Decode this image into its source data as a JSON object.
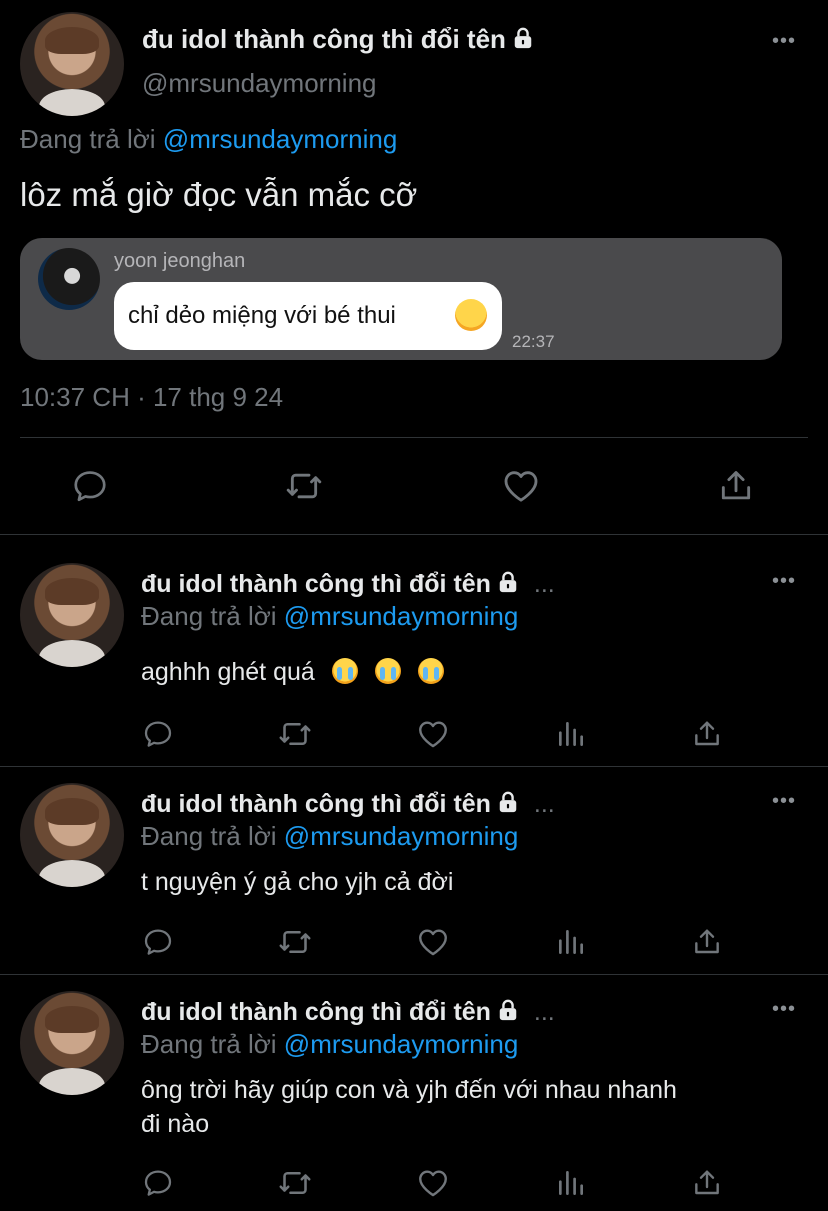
{
  "main_tweet": {
    "display_name": "đu idol thành công thì đổi tên",
    "handle": "@mrsundaymorning",
    "reply_prefix": "Đang trả lời",
    "reply_to": "@mrsundaymorning",
    "text": "lôz mắ giờ đọc vẫn mắc cỡ",
    "media": {
      "sender_name": "yoon jeonghan",
      "message": "chỉ dẻo miệng với bé thui",
      "time": "22:37"
    },
    "timestamp": "10:37 CH · 17 thg 9 24"
  },
  "replies": [
    {
      "display_name": "đu idol thành công thì đổi tên",
      "ellipsis": "...",
      "reply_prefix": "Đang trả lời",
      "reply_to": "@mrsundaymorning",
      "text": "aghhh ghét quá"
    },
    {
      "display_name": "đu idol thành công thì đổi tên",
      "ellipsis": "...",
      "reply_prefix": "Đang trả lời",
      "reply_to": "@mrsundaymorning",
      "text": "t nguyện ý gả cho yjh cả đời"
    },
    {
      "display_name": "đu idol thành công thì đổi tên",
      "ellipsis": "...",
      "reply_prefix": "Đang trả lời",
      "reply_to": "@mrsundaymorning",
      "text_line1": "ông trời hãy giúp con và yjh đến với nhau nhanh",
      "text_line2": "đi nào"
    }
  ],
  "colors": {
    "background": "#000000",
    "text": "#e7e9ea",
    "secondary": "#71767b",
    "accent": "#1d9bf0",
    "divider": "#2f3336"
  },
  "icons": [
    "lock-icon",
    "more-icon",
    "reply-icon",
    "retweet-icon",
    "like-icon",
    "views-icon",
    "share-icon",
    "crying-emoji",
    "yum-emoji"
  ]
}
